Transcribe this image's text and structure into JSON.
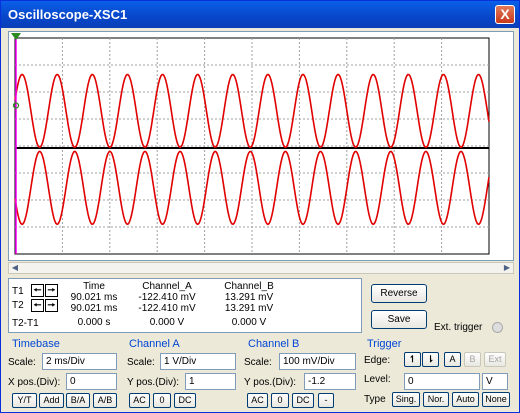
{
  "window": {
    "title": "Oscilloscope-XSC1",
    "close_glyph": "X"
  },
  "readout": {
    "rows": [
      "T1",
      "T2",
      "T2-T1"
    ],
    "headers": [
      "Time",
      "Channel_A",
      "Channel_B"
    ],
    "t1": {
      "time": "90.021 ms",
      "a": "-122.410 mV",
      "b": "13.291 mV"
    },
    "t2": {
      "time": "90.021 ms",
      "a": "-122.410 mV",
      "b": "13.291 mV"
    },
    "diff": {
      "time": "0.000 s",
      "a": "0.000 V",
      "b": "0.000 V"
    }
  },
  "buttons": {
    "reverse": "Reverse",
    "save": "Save",
    "ext_trigger": "Ext. trigger"
  },
  "timebase": {
    "title": "Timebase",
    "scale_label": "Scale:",
    "scale": "2 ms/Div",
    "xpos_label": "X pos.(Div):",
    "xpos": "0",
    "modes": [
      "Y/T",
      "Add",
      "B/A",
      "A/B"
    ]
  },
  "channel_a": {
    "title": "Channel A",
    "scale_label": "Scale:",
    "scale": "1 V/Div",
    "ypos_label": "Y pos.(Div):",
    "ypos": "1",
    "coupling": [
      "AC",
      "0",
      "DC"
    ]
  },
  "channel_b": {
    "title": "Channel B",
    "scale_label": "Scale:",
    "scale": "100 mV/Div",
    "ypos_label": "Y pos.(Div):",
    "ypos": "-1.2",
    "coupling": [
      "AC",
      "0",
      "DC",
      "-"
    ]
  },
  "trigger": {
    "title": "Trigger",
    "edge_label": "Edge:",
    "level_label": "Level:",
    "level": "0",
    "level_unit": "V",
    "sources": [
      "A",
      "B",
      "Ext"
    ],
    "type_label": "Type",
    "types": [
      "Sing.",
      "Nor.",
      "Auto",
      "None"
    ]
  },
  "colors": {
    "trace_a": "#e00000",
    "trace_b": "#000000",
    "cursor": "#ff00ff",
    "grid": "#a0a0a0"
  },
  "icons": {
    "scroll_left": "triangle-left",
    "scroll_right": "triangle-right",
    "cursor_marker": "triangle-down"
  }
}
